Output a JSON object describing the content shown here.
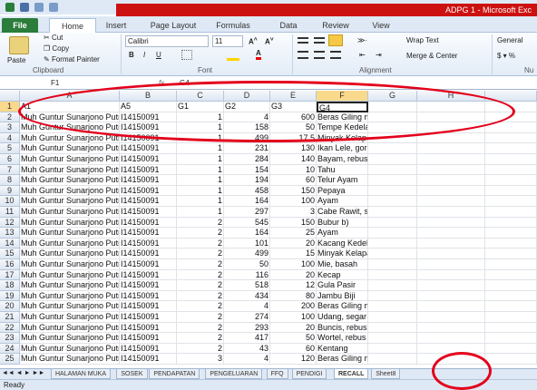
{
  "window": {
    "title": "ADPG 1 - Microsoft Exc"
  },
  "tabs": [
    "File",
    "Home",
    "Insert",
    "Page Layout",
    "Formulas",
    "Data",
    "Review",
    "View"
  ],
  "ribbon": {
    "clipboard": {
      "paste": "Paste",
      "cut": "Cut",
      "copy": "Copy",
      "format_painter": "Format Painter",
      "label": "Clipboard"
    },
    "font": {
      "name": "Calibri",
      "size": "11",
      "label": "Font"
    },
    "alignment": {
      "wrap": "Wrap Text",
      "merge": "Merge & Center",
      "label": "Alignment"
    },
    "number": {
      "format": "General",
      "label": "Nu"
    }
  },
  "formula_bar": {
    "name_box": "F1",
    "content": "G4"
  },
  "columns": [
    "A",
    "B",
    "C",
    "D",
    "E",
    "F",
    "G",
    "H"
  ],
  "rows": [
    [
      "A1",
      "A5",
      "G1",
      "G2",
      "G3",
      "G4"
    ],
    [
      "Muh Guntur Sunarjono Putra",
      "I14150091",
      "1",
      "4",
      "600",
      "Beras Giling masak (nasi)"
    ],
    [
      "Muh Guntur Sunarjono Putra",
      "I14150091",
      "1",
      "158",
      "50",
      "Tempe Kedelai Murni"
    ],
    [
      "Muh Guntur Sunarjono Putra",
      "I14150091",
      "1",
      "499",
      "17,5",
      "Minyak Kelapa Sawit"
    ],
    [
      "Muh Guntur Sunarjono Putra",
      "I14150091",
      "1",
      "231",
      "130",
      "Ikan Lele, goreng"
    ],
    [
      "Muh Guntur Sunarjono Putra",
      "I14150091",
      "1",
      "284",
      "140",
      "Bayam, rebus"
    ],
    [
      "Muh Guntur Sunarjono Putra",
      "I14150091",
      "1",
      "154",
      "10",
      "Tahu"
    ],
    [
      "Muh Guntur Sunarjono Putra",
      "I14150091",
      "1",
      "194",
      "60",
      "Telur Ayam"
    ],
    [
      "Muh Guntur Sunarjono Putra",
      "I14150091",
      "1",
      "458",
      "150",
      "Pepaya"
    ],
    [
      "Muh Guntur Sunarjono Putra",
      "I14150091",
      "1",
      "164",
      "100",
      "Ayam"
    ],
    [
      "Muh Guntur Sunarjono Putra",
      "I14150091",
      "1",
      "297",
      "3",
      "Cabe Rawit, segar"
    ],
    [
      "Muh Guntur Sunarjono Putra",
      "I14150091",
      "2",
      "545",
      "150",
      "Bubur b)"
    ],
    [
      "Muh Guntur Sunarjono Putra",
      "I14150091",
      "2",
      "164",
      "25",
      "Ayam"
    ],
    [
      "Muh Guntur Sunarjono Putra",
      "I14150091",
      "2",
      "101",
      "20",
      "Kacang Kedelai, kering"
    ],
    [
      "Muh Guntur Sunarjono Putra",
      "I14150091",
      "2",
      "499",
      "15",
      "Minyak Kelapa Sawit"
    ],
    [
      "Muh Guntur Sunarjono Putra",
      "I14150091",
      "2",
      "50",
      "100",
      "Mie, basah"
    ],
    [
      "Muh Guntur Sunarjono Putra",
      "I14150091",
      "2",
      "116",
      "20",
      "Kecap"
    ],
    [
      "Muh Guntur Sunarjono Putra",
      "I14150091",
      "2",
      "518",
      "12",
      "Gula Pasir"
    ],
    [
      "Muh Guntur Sunarjono Putra",
      "I14150091",
      "2",
      "434",
      "80",
      "Jambu Biji"
    ],
    [
      "Muh Guntur Sunarjono Putra",
      "I14150091",
      "2",
      "4",
      "200",
      "Beras Giling masak (nasi)"
    ],
    [
      "Muh Guntur Sunarjono Putra",
      "I14150091",
      "2",
      "274",
      "100",
      "Udang, segar"
    ],
    [
      "Muh Guntur Sunarjono Putra",
      "I14150091",
      "2",
      "293",
      "20",
      "Buncis, rebus"
    ],
    [
      "Muh Guntur Sunarjono Putra",
      "I14150091",
      "2",
      "417",
      "50",
      "Wortel, rebus"
    ],
    [
      "Muh Guntur Sunarjono Putra",
      "I14150091",
      "2",
      "43",
      "60",
      "Kentang"
    ],
    [
      "Muh Guntur Sunarjono Putra",
      "I14150091",
      "3",
      "4",
      "120",
      "Beras Giling masak (nasi)"
    ]
  ],
  "sheets": [
    "HALAMAN MUKA",
    "SOSEK",
    "PENDAPATAN",
    "PENGELUARAN",
    "FFQ",
    "PENDIGI",
    "RECALL",
    "Sheet8"
  ],
  "active_sheet": "RECALL",
  "status": "Ready"
}
